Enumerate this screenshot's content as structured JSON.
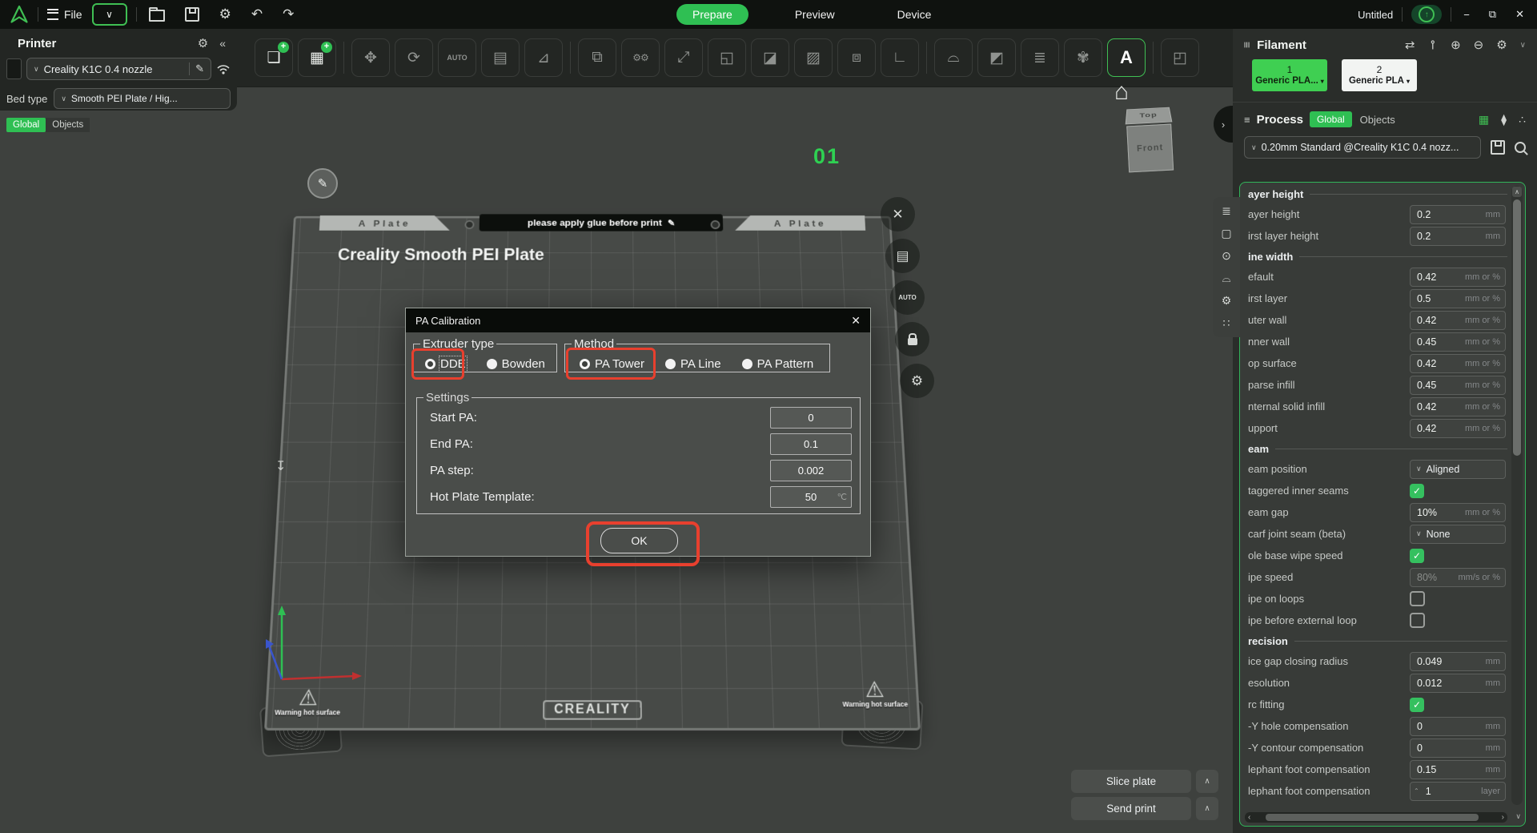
{
  "colors": {
    "accent": "#2fbf53",
    "annotation": "#e8402e",
    "panel_green_border": "#31b45a",
    "plate_number_green": "#2ed152"
  },
  "topbar": {
    "file_label": "File",
    "doc_title": "Untitled",
    "tabs": [
      {
        "label": "Prepare",
        "active": true
      },
      {
        "label": "Preview",
        "active": false
      },
      {
        "label": "Device",
        "active": false
      }
    ],
    "left_icons": [
      {
        "name": "open-file",
        "kind": "folder"
      },
      {
        "name": "save",
        "kind": "floppy"
      },
      {
        "name": "settings",
        "glyph": "⚙"
      },
      {
        "name": "undo",
        "glyph": "↶"
      },
      {
        "name": "redo",
        "glyph": "↷"
      }
    ],
    "window_controls": [
      {
        "name": "minimize",
        "glyph": "−"
      },
      {
        "name": "restore",
        "glyph": "⧉"
      },
      {
        "name": "close",
        "glyph": "✕"
      }
    ]
  },
  "toolbar": {
    "icons": [
      {
        "name": "add-model",
        "glyph": "❏",
        "badge": "+",
        "enabled": true
      },
      {
        "name": "add-plate",
        "glyph": "▦",
        "badge": "+",
        "enabled": true
      },
      {
        "divider": true
      },
      {
        "name": "move",
        "glyph": "✥"
      },
      {
        "name": "rotate",
        "glyph": "⟳"
      },
      {
        "name": "auto-orient",
        "glyph": "AUTO"
      },
      {
        "name": "arrange",
        "glyph": "▤"
      },
      {
        "name": "lay-flat",
        "glyph": "⊿"
      },
      {
        "divider": true
      },
      {
        "name": "clone",
        "glyph": "⧉"
      },
      {
        "name": "batch-settings",
        "glyph": "⚙⚙"
      },
      {
        "name": "scale",
        "glyph": "⤢"
      },
      {
        "name": "split-objects",
        "glyph": "◱"
      },
      {
        "name": "cut",
        "glyph": "◪"
      },
      {
        "name": "fuzzy-skin",
        "glyph": "▨"
      },
      {
        "name": "boolean",
        "glyph": "⧈"
      },
      {
        "name": "measure",
        "glyph": "∟"
      },
      {
        "divider": true
      },
      {
        "name": "support-paint",
        "glyph": "⌓"
      },
      {
        "name": "crack-model",
        "glyph": "◩"
      },
      {
        "name": "simplify",
        "glyph": "≣"
      },
      {
        "name": "color-paint",
        "glyph": "✾"
      },
      {
        "name": "text-tool",
        "glyph": "A",
        "enabled": true,
        "highlight": true
      },
      {
        "divider": true
      },
      {
        "name": "plugin",
        "glyph": "◰"
      }
    ]
  },
  "printer": {
    "title": "Printer",
    "name": "Creality K1C 0.4 nozzle",
    "bed_type_label": "Bed type",
    "bed_type": "Smooth PEI Plate / Hig...",
    "view_tabs": [
      {
        "label": "Global",
        "active": true
      },
      {
        "label": "Objects",
        "active": false
      }
    ]
  },
  "viewport": {
    "plate_tab": "A Plate",
    "glue_note": "please apply glue before print",
    "plate_name": "Creality Smooth PEI Plate",
    "brand": "CREALITY",
    "warning": "Warning hot surface",
    "plate_number": "01",
    "view_cube_top": "Top",
    "view_cube_front": "Front",
    "plate_buttons": [
      {
        "name": "delete-plate",
        "glyph": "✕"
      },
      {
        "name": "plate-settings-list",
        "glyph": "▤"
      },
      {
        "name": "auto-arrange-plate",
        "glyph": "AUTO"
      },
      {
        "name": "lock-plate",
        "kind": "lock"
      },
      {
        "name": "plate-gear",
        "glyph": "⚙"
      }
    ]
  },
  "dialog": {
    "title": "PA Calibration",
    "extruder": {
      "legend": "Extruder type",
      "options": [
        {
          "label": "DDE",
          "selected": true,
          "focus": true
        },
        {
          "label": "Bowden",
          "selected": false
        }
      ]
    },
    "method": {
      "legend": "Method",
      "options": [
        {
          "label": "PA Tower",
          "selected": true
        },
        {
          "label": "PA Line",
          "selected": false
        },
        {
          "label": "PA Pattern",
          "selected": false
        }
      ]
    },
    "settings": {
      "legend": "Settings",
      "rows": [
        {
          "name": "start-pa",
          "label": "Start PA:",
          "value": "0"
        },
        {
          "name": "end-pa",
          "label": "End PA:",
          "value": "0.1"
        },
        {
          "name": "pa-step",
          "label": "PA step:",
          "value": "0.002"
        },
        {
          "name": "hot-plate-template",
          "label": "Hot Plate Template:",
          "value": "50",
          "unit": "℃"
        }
      ]
    },
    "ok_label": "OK"
  },
  "sidebar": {
    "filament": {
      "title": "Filament",
      "header_icons": [
        {
          "name": "sync-filament",
          "glyph": "⇄"
        },
        {
          "name": "flush-volumes",
          "glyph": "⊸",
          "rot": true
        },
        {
          "name": "add-filament",
          "glyph": "⊕"
        },
        {
          "name": "remove-filament",
          "glyph": "⊖"
        },
        {
          "name": "filament-settings",
          "glyph": "⚙"
        },
        {
          "name": "collapse-filament",
          "glyph": "∨",
          "small": true
        }
      ],
      "slots": [
        {
          "index": "1",
          "name": "Generic PLA...",
          "bg": "#3fcf52",
          "fg": "#10240f",
          "selected": true
        },
        {
          "index": "2",
          "name": "Generic PLA",
          "bg": "#f2f4f2",
          "fg": "#17191a",
          "selected": false
        }
      ]
    },
    "process": {
      "title": "Process",
      "global_tab": "Global",
      "objects_tab": "Objects",
      "header_icons": [
        {
          "name": "parameter-table",
          "glyph": "▦",
          "accent": true
        },
        {
          "name": "preset-tag",
          "glyph": "⧫"
        },
        {
          "name": "compare-presets",
          "glyph": "∴"
        }
      ],
      "preset": "0.20mm Standard @Creality K1C 0.4 nozz...",
      "categories": [
        {
          "name": "category-quality",
          "glyph": "≣"
        },
        {
          "name": "category-strength",
          "glyph": "▢"
        },
        {
          "name": "category-speed",
          "glyph": "⊙"
        },
        {
          "name": "category-support",
          "glyph": "⌓"
        },
        {
          "name": "category-others",
          "glyph": "⚙"
        },
        {
          "name": "category-multimaterial",
          "glyph": "∷"
        }
      ]
    },
    "params": {
      "sections": [
        {
          "header": "ayer height",
          "rows": [
            {
              "name": "layer-height",
              "label": "ayer height",
              "type": "input",
              "value": "0.2",
              "unit": "mm"
            },
            {
              "name": "first-layer-height",
              "label": "irst layer height",
              "type": "input",
              "value": "0.2",
              "unit": "mm"
            }
          ]
        },
        {
          "header": "ine width",
          "rows": [
            {
              "name": "default-line-width",
              "label": "efault",
              "type": "input",
              "value": "0.42",
              "unit": "mm or %"
            },
            {
              "name": "first-layer-line-width",
              "label": "irst layer",
              "type": "input",
              "value": "0.5",
              "unit": "mm or %"
            },
            {
              "name": "outer-wall-line-width",
              "label": "uter wall",
              "type": "input",
              "value": "0.42",
              "unit": "mm or %"
            },
            {
              "name": "inner-wall-line-width",
              "label": "nner wall",
              "type": "input",
              "value": "0.45",
              "unit": "mm or %"
            },
            {
              "name": "top-surface-line-width",
              "label": "op surface",
              "type": "input",
              "value": "0.42",
              "unit": "mm or %"
            },
            {
              "name": "sparse-infill-line-width",
              "label": "parse infill",
              "type": "input",
              "value": "0.45",
              "unit": "mm or %"
            },
            {
              "name": "internal-solid-infill-line-width",
              "label": "nternal solid infill",
              "type": "input",
              "value": "0.42",
              "unit": "mm or %"
            },
            {
              "name": "support-line-width",
              "label": "upport",
              "type": "input",
              "value": "0.42",
              "unit": "mm or %"
            }
          ]
        },
        {
          "header": "eam",
          "rows": [
            {
              "name": "seam-position",
              "label": "eam position",
              "type": "select",
              "value": "Aligned"
            },
            {
              "name": "staggered-inner-seams",
              "label": "taggered inner seams",
              "type": "check",
              "checked": true
            },
            {
              "name": "seam-gap",
              "label": "eam gap",
              "type": "input",
              "value": "10%",
              "unit": "mm or %"
            },
            {
              "name": "scarf-joint-seam",
              "label": "carf joint seam (beta)",
              "type": "select",
              "value": "None"
            },
            {
              "name": "role-base-wipe-speed",
              "label": "ole base wipe speed",
              "type": "check",
              "checked": true
            },
            {
              "name": "wipe-speed",
              "label": "ipe speed",
              "type": "input",
              "value": "80%",
              "unit": "mm/s or %",
              "dim": true
            },
            {
              "name": "wipe-on-loops",
              "label": "ipe on loops",
              "type": "check",
              "checked": false
            },
            {
              "name": "wipe-before-external-loop",
              "label": "ipe before external loop",
              "type": "check",
              "checked": false
            }
          ]
        },
        {
          "header": "recision",
          "rows": [
            {
              "name": "slice-gap-closing-radius",
              "label": "ice gap closing radius",
              "type": "input",
              "value": "0.049",
              "unit": "mm"
            },
            {
              "name": "resolution",
              "label": "esolution",
              "type": "input",
              "value": "0.012",
              "unit": "mm"
            },
            {
              "name": "arc-fitting",
              "label": "rc fitting",
              "type": "check",
              "checked": true
            },
            {
              "name": "xy-hole-compensation",
              "label": "-Y hole compensation",
              "type": "input",
              "value": "0",
              "unit": "mm"
            },
            {
              "name": "xy-contour-compensation",
              "label": "-Y contour compensation",
              "type": "input",
              "value": "0",
              "unit": "mm"
            },
            {
              "name": "elephant-foot-compensation",
              "label": "lephant foot compensation",
              "type": "input",
              "value": "0.15",
              "unit": "mm"
            },
            {
              "name": "elephant-foot-layers",
              "label": "lephant foot compensation",
              "type": "spin",
              "value": "1",
              "unit": "layer"
            }
          ]
        }
      ]
    }
  },
  "actions": {
    "slice_label": "Slice plate",
    "send_label": "Send print"
  }
}
